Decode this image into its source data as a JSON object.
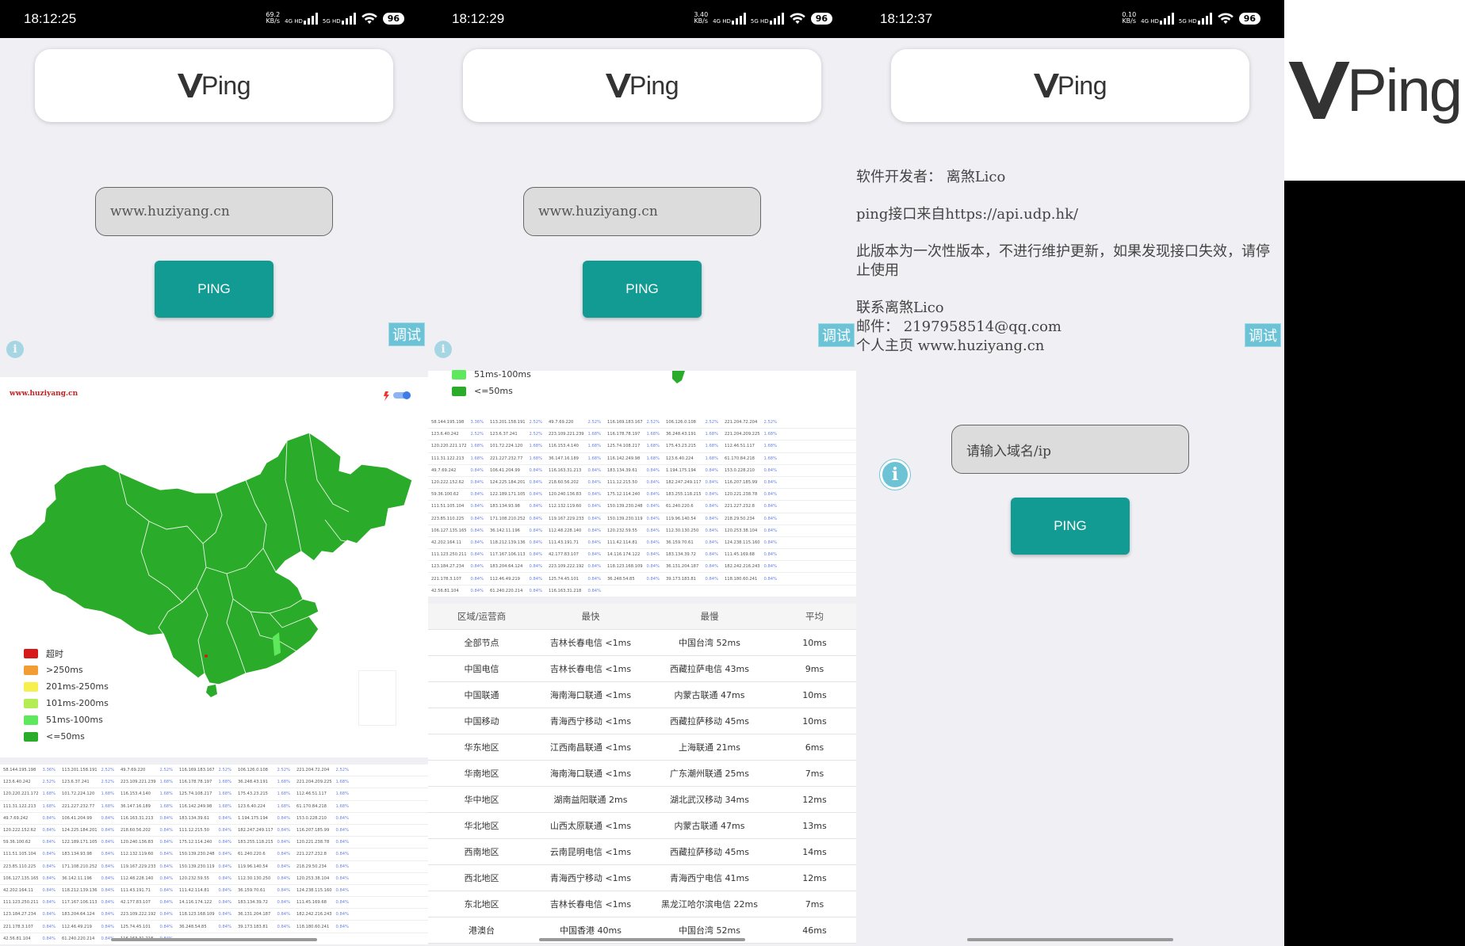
{
  "screens": [
    {
      "time": "18:12:25",
      "speed": "69.2",
      "speed_unit": "KB/s",
      "battery": "96"
    },
    {
      "time": "18:12:29",
      "speed": "3.40",
      "speed_unit": "KB/s",
      "battery": "96"
    },
    {
      "time": "18:12:37",
      "speed": "0.10",
      "speed_unit": "KB/s",
      "battery": "96"
    }
  ],
  "net_labels": {
    "sim1": "4G HD",
    "sim2": "5G HD"
  },
  "logo_text": "Ping",
  "input_value": "www.huziyang.cn",
  "input_placeholder": "请输入域名/ip",
  "ping_button": "PING",
  "debug_label": "调试",
  "map_watermark": "www.huziyang.cn",
  "legend": [
    {
      "label": "超时",
      "color": "#d7191c"
    },
    {
      "label": ">250ms",
      "color": "#f39c33"
    },
    {
      "label": "201ms-250ms",
      "color": "#f7ef4c"
    },
    {
      "label": "101ms-200ms",
      "color": "#b4ec55"
    },
    {
      "label": "51ms-100ms",
      "color": "#5ee85b"
    },
    {
      "label": "<=50ms",
      "color": "#2bab2a"
    }
  ],
  "legend_partial": [
    {
      "label": "51ms-100ms",
      "color": "#5ee85b"
    },
    {
      "label": "<=50ms",
      "color": "#2bab2a"
    }
  ],
  "ip_rows": [
    [
      [
        "58.144.195.198",
        "3.36%"
      ],
      [
        "113.201.158.191",
        "2.52%"
      ],
      [
        "49.7.69.220",
        "2.52%"
      ],
      [
        "116.169.183.167",
        "2.52%"
      ],
      [
        "106.126.0.108",
        "2.52%"
      ],
      [
        "221.204.72.204",
        "2.52%"
      ]
    ],
    [
      [
        "123.6.40.242",
        "2.52%"
      ],
      [
        "123.6.37.241",
        "2.52%"
      ],
      [
        "223.109.221.239",
        "1.68%"
      ],
      [
        "116.178.78.197",
        "1.68%"
      ],
      [
        "36.248.43.191",
        "1.68%"
      ],
      [
        "221.204.209.225",
        "1.68%"
      ]
    ],
    [
      [
        "120.220.221.172",
        "1.68%"
      ],
      [
        "101.72.224.120",
        "1.68%"
      ],
      [
        "116.153.4.140",
        "1.68%"
      ],
      [
        "125.74.108.217",
        "1.68%"
      ],
      [
        "175.43.23.215",
        "1.68%"
      ],
      [
        "112.46.51.117",
        "1.68%"
      ]
    ],
    [
      [
        "111.31.122.213",
        "1.68%"
      ],
      [
        "221.227.232.77",
        "1.68%"
      ],
      [
        "36.147.16.189",
        "1.68%"
      ],
      [
        "116.142.249.98",
        "1.68%"
      ],
      [
        "123.6.40.224",
        "1.68%"
      ],
      [
        "61.170.84.218",
        "1.68%"
      ]
    ],
    [
      [
        "49.7.69.242",
        "0.84%"
      ],
      [
        "106.41.204.99",
        "0.84%"
      ],
      [
        "116.163.31.213",
        "0.84%"
      ],
      [
        "183.134.39.61",
        "0.84%"
      ],
      [
        "1.194.175.194",
        "0.84%"
      ],
      [
        "153.0.228.210",
        "0.84%"
      ]
    ],
    [
      [
        "120.222.152.62",
        "0.84%"
      ],
      [
        "124.225.184.201",
        "0.84%"
      ],
      [
        "218.60.56.202",
        "0.84%"
      ],
      [
        "111.12.215.50",
        "0.84%"
      ],
      [
        "182.247.249.117",
        "0.84%"
      ],
      [
        "116.207.185.99",
        "0.84%"
      ]
    ],
    [
      [
        "59.36.100.62",
        "0.84%"
      ],
      [
        "122.189.171.105",
        "0.84%"
      ],
      [
        "120.240.136.83",
        "0.84%"
      ],
      [
        "175.12.114.240",
        "0.84%"
      ],
      [
        "183.255.118.215",
        "0.84%"
      ],
      [
        "120.221.238.78",
        "0.84%"
      ]
    ],
    [
      [
        "111.51.105.104",
        "0.84%"
      ],
      [
        "183.134.93.98",
        "0.84%"
      ],
      [
        "112.132.119.60",
        "0.84%"
      ],
      [
        "150.139.230.248",
        "0.84%"
      ],
      [
        "61.240.220.6",
        "0.84%"
      ],
      [
        "221.227.232.8",
        "0.84%"
      ]
    ],
    [
      [
        "223.85.110.225",
        "0.84%"
      ],
      [
        "171.108.210.252",
        "0.84%"
      ],
      [
        "119.167.229.233",
        "0.84%"
      ],
      [
        "150.139.230.119",
        "0.84%"
      ],
      [
        "119.96.140.54",
        "0.84%"
      ],
      [
        "218.29.50.234",
        "0.84%"
      ]
    ],
    [
      [
        "106.127.135.165",
        "0.84%"
      ],
      [
        "36.142.11.196",
        "0.84%"
      ],
      [
        "112.48.228.140",
        "0.84%"
      ],
      [
        "120.232.59.55",
        "0.84%"
      ],
      [
        "112.30.130.250",
        "0.84%"
      ],
      [
        "120.253.38.104",
        "0.84%"
      ]
    ],
    [
      [
        "42.202.164.11",
        "0.84%"
      ],
      [
        "118.212.139.136",
        "0.84%"
      ],
      [
        "111.43.191.71",
        "0.84%"
      ],
      [
        "111.42.114.81",
        "0.84%"
      ],
      [
        "36.159.70.61",
        "0.84%"
      ],
      [
        "124.238.115.160",
        "0.84%"
      ]
    ],
    [
      [
        "111.123.250.211",
        "0.84%"
      ],
      [
        "117.167.106.113",
        "0.84%"
      ],
      [
        "42.177.83.107",
        "0.84%"
      ],
      [
        "14.116.174.122",
        "0.84%"
      ],
      [
        "183.134.39.72",
        "0.84%"
      ],
      [
        "111.45.169.68",
        "0.84%"
      ]
    ],
    [
      [
        "123.184.27.234",
        "0.84%"
      ],
      [
        "183.204.64.124",
        "0.84%"
      ],
      [
        "223.109.222.192",
        "0.84%"
      ],
      [
        "118.123.168.109",
        "0.84%"
      ],
      [
        "36.131.204.187",
        "0.84%"
      ],
      [
        "182.242.216.243",
        "0.84%"
      ]
    ],
    [
      [
        "221.178.3.107",
        "0.84%"
      ],
      [
        "112.46.49.219",
        "0.84%"
      ],
      [
        "125.74.45.101",
        "0.84%"
      ],
      [
        "36.248.54.85",
        "0.84%"
      ],
      [
        "39.173.183.81",
        "0.84%"
      ],
      [
        "118.180.60.241",
        "0.84%"
      ]
    ],
    [
      [
        "42.56.81.104",
        "0.84%"
      ],
      [
        "61.240.220.214",
        "0.84%"
      ],
      [
        "116.163.31.218",
        "0.84%"
      ]
    ]
  ],
  "region_header": [
    "区域/运营商",
    "最快",
    "最慢",
    "平均"
  ],
  "region_rows": [
    [
      "全部节点",
      "吉林长春电信 <1ms",
      "中国台湾 52ms",
      "10ms"
    ],
    [
      "中国电信",
      "吉林长春电信 <1ms",
      "西藏拉萨电信 43ms",
      "9ms"
    ],
    [
      "中国联通",
      "海南海口联通 <1ms",
      "内蒙古联通 47ms",
      "10ms"
    ],
    [
      "中国移动",
      "青海西宁移动 <1ms",
      "西藏拉萨移动 45ms",
      "10ms"
    ],
    [
      "华东地区",
      "江西南昌联通 <1ms",
      "上海联通 21ms",
      "6ms"
    ],
    [
      "华南地区",
      "海南海口联通 <1ms",
      "广东潮州联通 25ms",
      "7ms"
    ],
    [
      "华中地区",
      "湖南益阳联通 2ms",
      "湖北武汉移动 34ms",
      "12ms"
    ],
    [
      "华北地区",
      "山西太原联通 <1ms",
      "内蒙古联通 47ms",
      "13ms"
    ],
    [
      "西南地区",
      "云南昆明电信 <1ms",
      "西藏拉萨移动 45ms",
      "14ms"
    ],
    [
      "西北地区",
      "青海西宁移动 <1ms",
      "青海西宁电信 41ms",
      "12ms"
    ],
    [
      "东北地区",
      "吉林长春电信 <1ms",
      "黑龙江哈尔滨电信 22ms",
      "7ms"
    ],
    [
      "港澳台",
      "中国香港 40ms",
      "中国台湾 52ms",
      "46ms"
    ]
  ],
  "about": {
    "developer": "软件开发者： 离煞Lico",
    "api": "ping接口来自https://api.udp.hk/",
    "notice": "此版本为一次性版本，不进行维护更新，如果发现接口失效，请停止使用",
    "contact": "联系离煞Lico",
    "email": "邮件： 2197958514@qq.com",
    "homepage": "个人主页 www.huziyang.cn"
  },
  "colors": {
    "accent": "#119b93",
    "map_green": "#2bab2a",
    "debug": "#6cc3d6"
  },
  "icons": [
    "wifi-icon",
    "signal-icon",
    "battery-icon",
    "info-icon",
    "vping-logo",
    "toggle-icon"
  ]
}
